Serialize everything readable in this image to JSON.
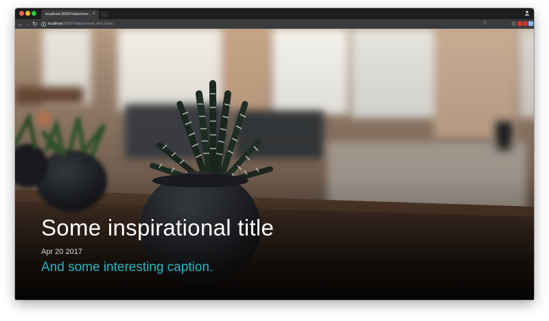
{
  "browser": {
    "tab": {
      "title": "localhost:3000/?attachme…",
      "close_glyph": "×"
    },
    "nav": {
      "back_icon": "arrow-left-icon",
      "forward_icon": "arrow-right-icon",
      "reload_icon": "reload-icon"
    },
    "address": {
      "host": "localhost",
      "rest": ":3000/?attachment_id=17&ely"
    },
    "extensions": [
      "extension-icon",
      "extension-icon",
      "extension-icon",
      "extension-icon"
    ],
    "menu_icon": "kebab-menu-icon"
  },
  "slide": {
    "title": "Some inspirational title",
    "date": "Apr 20 2017",
    "caption": "And some interesting caption."
  },
  "colors": {
    "caption": "#2bb6c6",
    "title": "#ffffff",
    "chrome_dark": "#1d1d1f",
    "toolbar": "#3a3b3d"
  }
}
